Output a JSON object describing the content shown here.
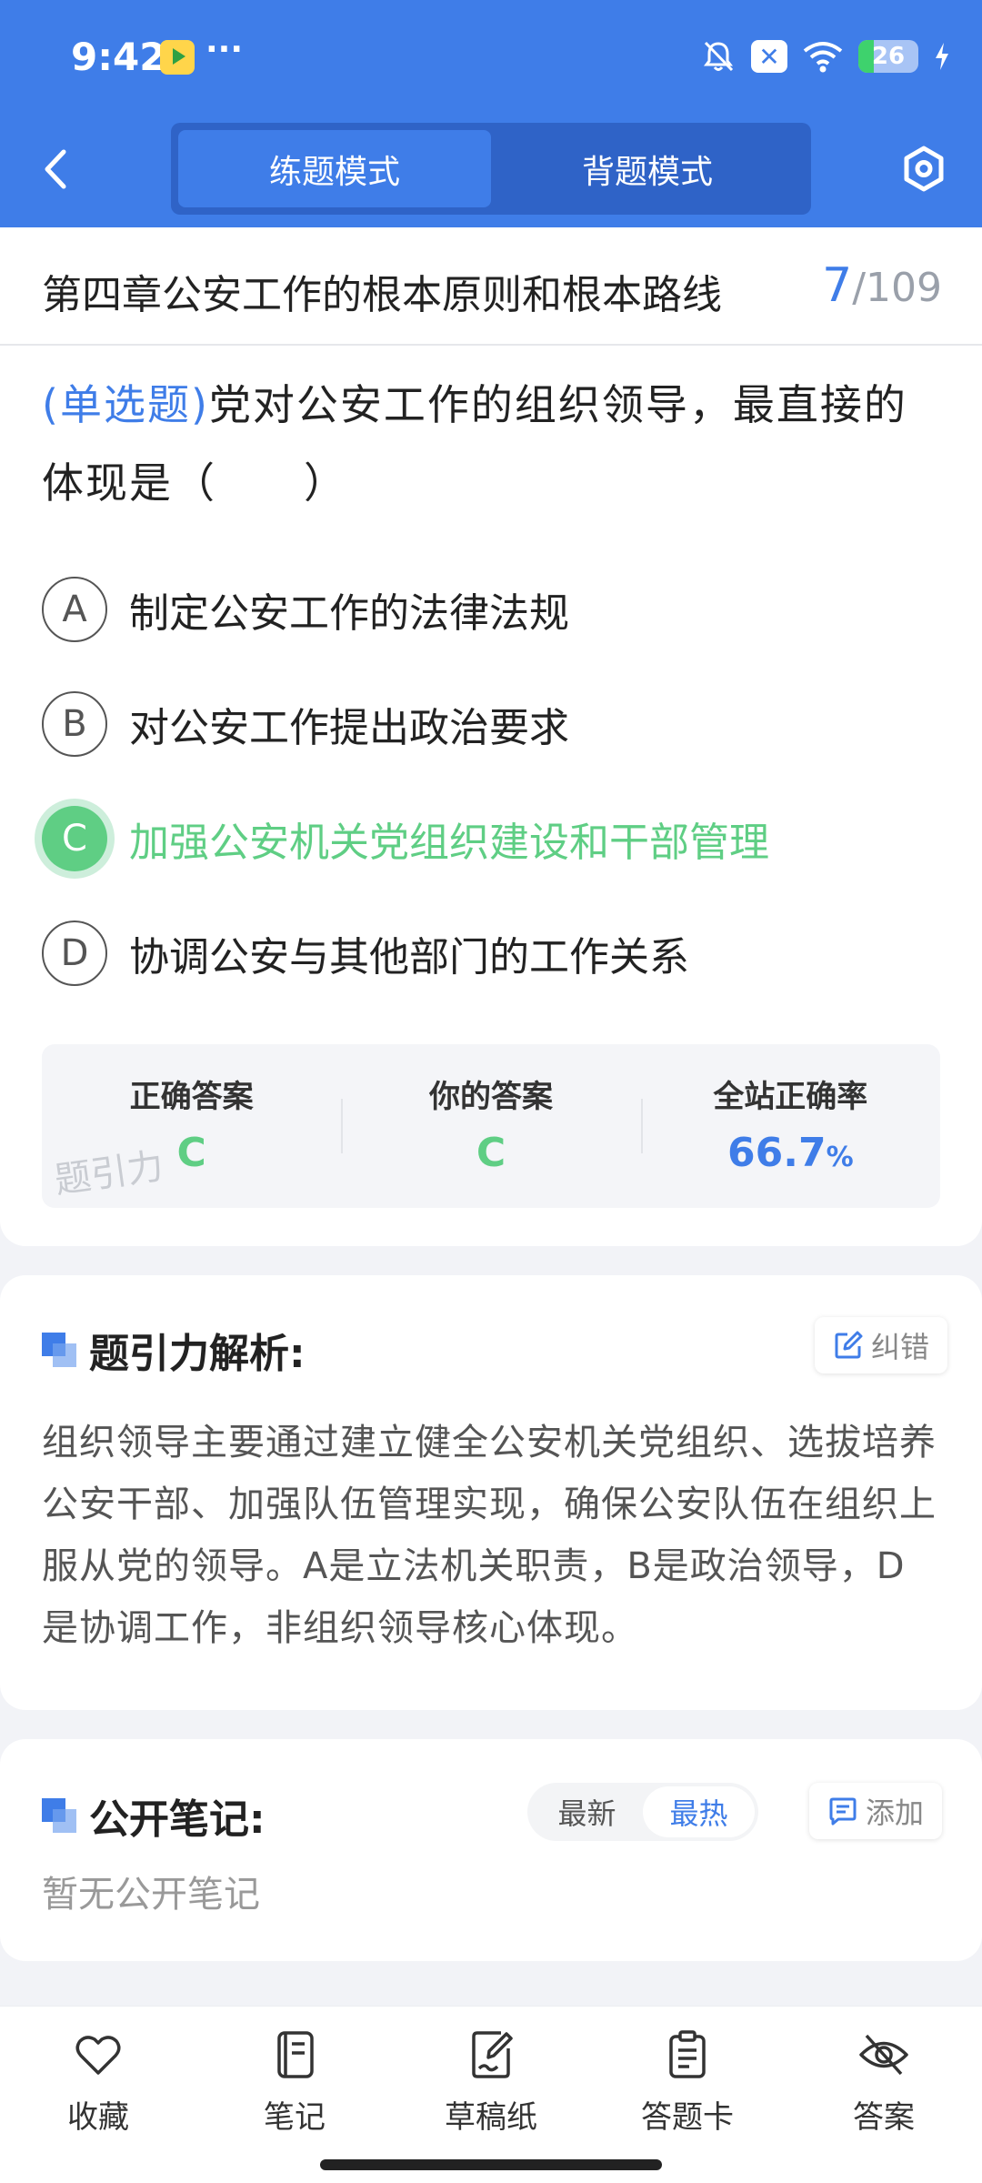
{
  "status_bar": {
    "time": "9:42",
    "dots": "···",
    "x_badge": "✕",
    "battery_level": "26",
    "battery_percent": 26
  },
  "nav": {
    "mode_tabs": [
      {
        "label": "练题模式",
        "active": true
      },
      {
        "label": "背题模式",
        "active": false
      }
    ]
  },
  "chapter": {
    "title": "第四章公安工作的根本原则和根本路线",
    "current": "7",
    "separator": "/",
    "total": "109"
  },
  "question": {
    "type": "(单选题)",
    "text": "党对公安工作的组织领导，最直接的体现是（　　）",
    "options": [
      {
        "letter": "A",
        "text": "制定公安工作的法律法规",
        "state": "normal"
      },
      {
        "letter": "B",
        "text": "对公安工作提出政治要求",
        "state": "normal"
      },
      {
        "letter": "C",
        "text": "加强公安机关党组织建设和干部管理",
        "state": "correct"
      },
      {
        "letter": "D",
        "text": "协调公安与其他部门的工作关系",
        "state": "normal"
      }
    ]
  },
  "answer_summary": {
    "correct_label": "正确答案",
    "correct_value": "C",
    "yours_label": "你的答案",
    "yours_value": "C",
    "rate_label": "全站正确率",
    "rate_value": "66.7",
    "rate_unit": "%",
    "watermark": "题引力"
  },
  "analysis": {
    "title": "题引力解析:",
    "correct_button": "纠错",
    "text": "组织领导主要通过建立健全公安机关党组织、选拔培养公安干部、加强队伍管理实现，确保公安队伍在组织上服从党的领导。A是立法机关职责，B是政治领导，D是协调工作，非组织领导核心体现。"
  },
  "notes": {
    "title": "公开笔记:",
    "sort_tabs": [
      {
        "label": "最新",
        "active": false
      },
      {
        "label": "最热",
        "active": true
      }
    ],
    "add_button": "添加",
    "empty_text": "暂无公开笔记"
  },
  "bottom_nav": [
    {
      "label": "收藏",
      "icon": "heart-icon"
    },
    {
      "label": "笔记",
      "icon": "notebook-icon"
    },
    {
      "label": "草稿纸",
      "icon": "draft-icon"
    },
    {
      "label": "答题卡",
      "icon": "answer-card-icon"
    },
    {
      "label": "答案",
      "icon": "eye-off-icon"
    }
  ],
  "colors": {
    "primary": "#3f7de8",
    "correct": "#5fce84",
    "muted": "#9aa0aa"
  }
}
